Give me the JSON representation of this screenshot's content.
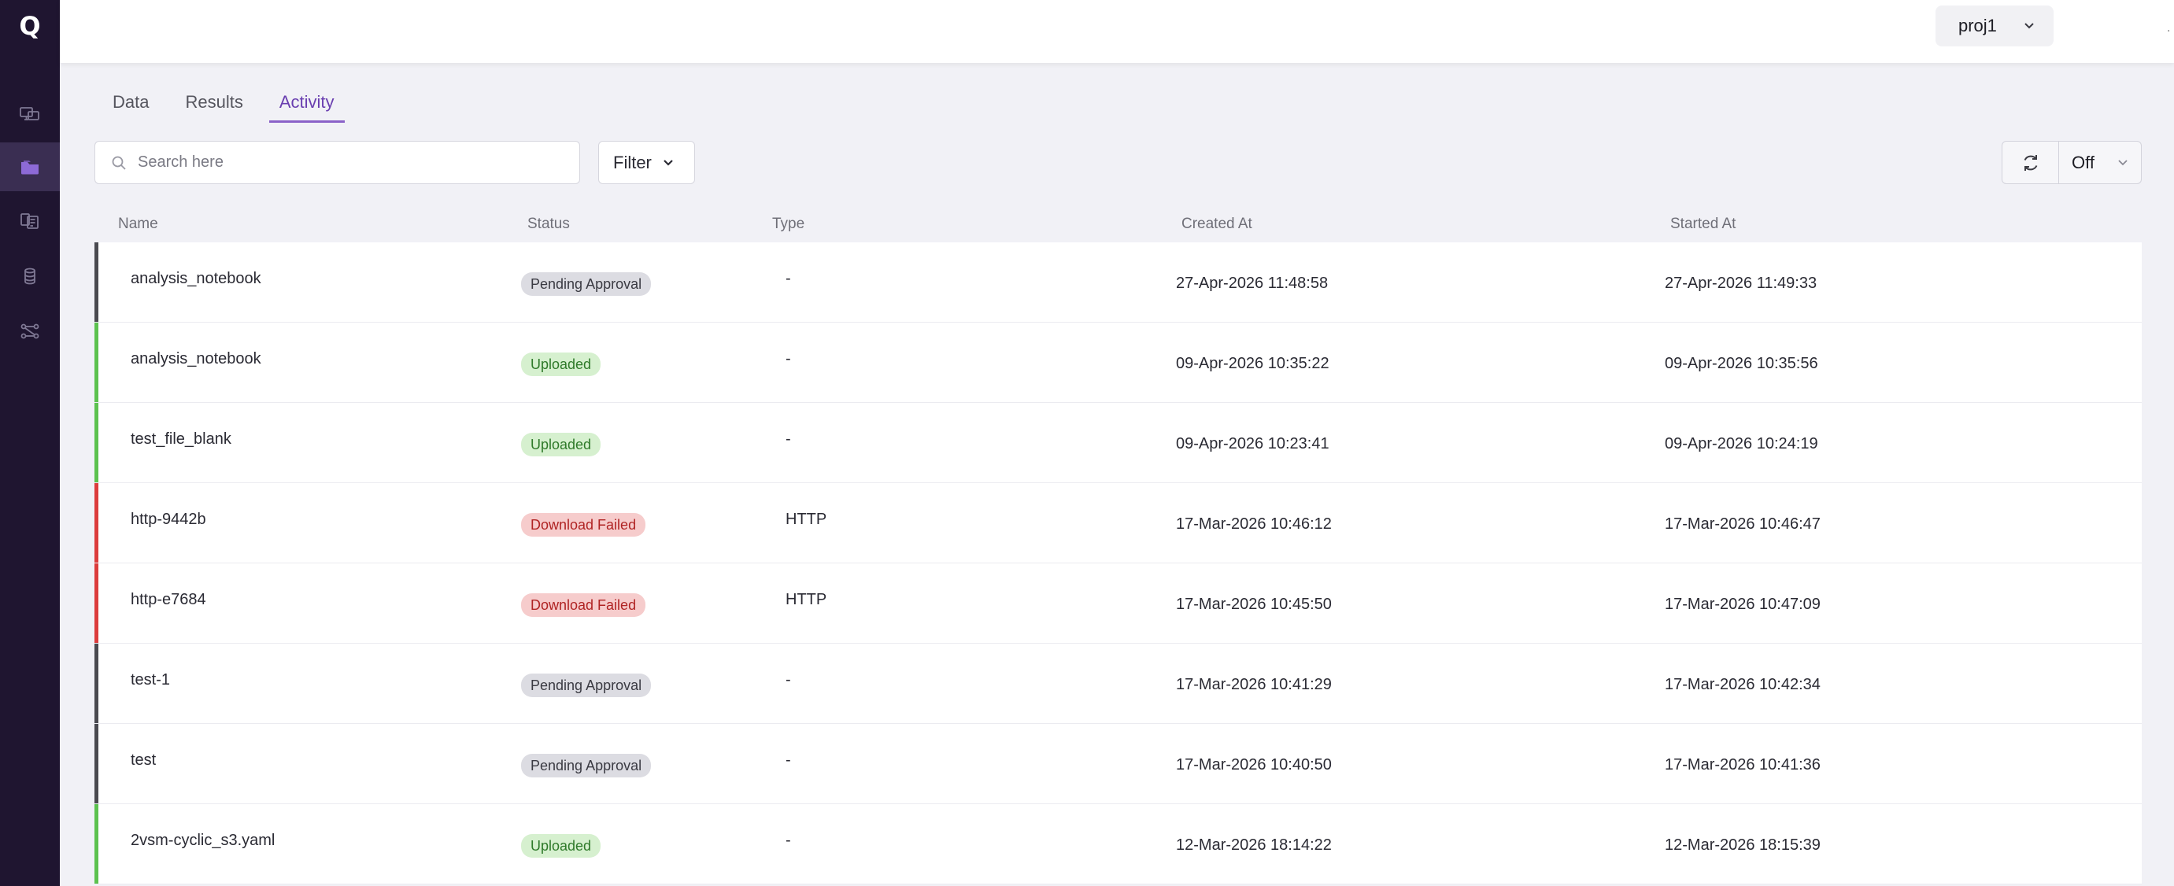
{
  "sidebar": {
    "logo": "Q",
    "items": [
      {
        "icon": "monitor-stack-icon",
        "active": false
      },
      {
        "icon": "folder-icon",
        "active": true
      },
      {
        "icon": "notebook-icon",
        "active": false
      },
      {
        "icon": "database-icon",
        "active": false
      },
      {
        "icon": "workflow-icon",
        "active": false
      }
    ]
  },
  "header": {
    "project": "proj1",
    "corner_mark": "."
  },
  "tabs": [
    {
      "label": "Data",
      "active": false
    },
    {
      "label": "Results",
      "active": false
    },
    {
      "label": "Activity",
      "active": true
    }
  ],
  "toolbar": {
    "search_placeholder": "Search here",
    "filter_label": "Filter",
    "refresh_interval": "Off"
  },
  "table": {
    "columns": [
      "Name",
      "Status",
      "Type",
      "Created At",
      "Started At"
    ],
    "rows": [
      {
        "name": "analysis_notebook",
        "status": "Pending Approval",
        "type": "-",
        "created": "27-Apr-2026 11:48:58",
        "started": "27-Apr-2026 11:49:33"
      },
      {
        "name": "analysis_notebook",
        "status": "Uploaded",
        "type": "-",
        "created": "09-Apr-2026 10:35:22",
        "started": "09-Apr-2026 10:35:56"
      },
      {
        "name": "test_file_blank",
        "status": "Uploaded",
        "type": "-",
        "created": "09-Apr-2026 10:23:41",
        "started": "09-Apr-2026 10:24:19"
      },
      {
        "name": "http-9442b",
        "status": "Download Failed",
        "type": "HTTP",
        "created": "17-Mar-2026 10:46:12",
        "started": "17-Mar-2026 10:46:47"
      },
      {
        "name": "http-e7684",
        "status": "Download Failed",
        "type": "HTTP",
        "created": "17-Mar-2026 10:45:50",
        "started": "17-Mar-2026 10:47:09"
      },
      {
        "name": "test-1",
        "status": "Pending Approval",
        "type": "-",
        "created": "17-Mar-2026 10:41:29",
        "started": "17-Mar-2026 10:42:34"
      },
      {
        "name": "test",
        "status": "Pending Approval",
        "type": "-",
        "created": "17-Mar-2026 10:40:50",
        "started": "17-Mar-2026 10:41:36"
      },
      {
        "name": "2vsm-cyclic_s3.yaml",
        "status": "Uploaded",
        "type": "-",
        "created": "12-Mar-2026 18:14:22",
        "started": "12-Mar-2026 18:15:39"
      }
    ]
  },
  "status_styles": {
    "Pending Approval": {
      "stripe": "#4a4a50",
      "bg": "#dcdce2",
      "fg": "#3a3a42"
    },
    "Uploaded": {
      "stripe": "#5cc24f",
      "bg": "#d6f0cf",
      "fg": "#2f7a2a"
    },
    "Download Failed": {
      "stripe": "#dc3c3c",
      "bg": "#f6cccc",
      "fg": "#b02424"
    }
  },
  "colors": {
    "sidebar_bg": "#1f1530",
    "accent": "#6a3fb0",
    "page_bg": "#f1f1f6"
  }
}
